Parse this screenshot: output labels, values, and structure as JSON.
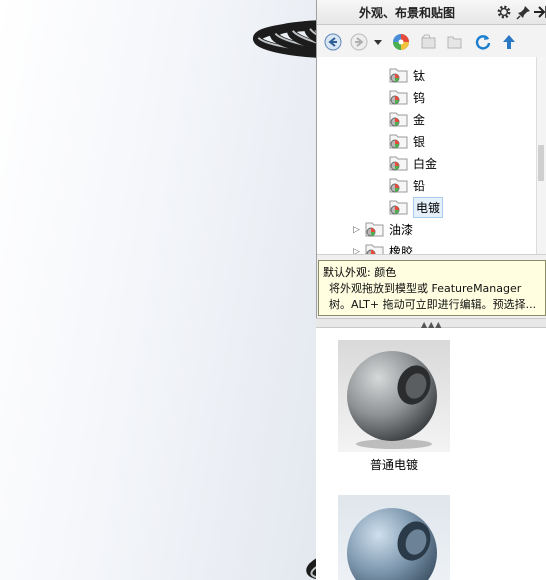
{
  "panel": {
    "title": "外观、布景和贴图",
    "tree": [
      {
        "label": "钛",
        "selected": false
      },
      {
        "label": "钨",
        "selected": false
      },
      {
        "label": "金",
        "selected": false
      },
      {
        "label": "银",
        "selected": false
      },
      {
        "label": "白金",
        "selected": false
      },
      {
        "label": "铅",
        "selected": false
      },
      {
        "label": "电镀",
        "selected": true
      },
      {
        "label": "油漆",
        "selected": false
      },
      {
        "label": "橡胶",
        "selected": false
      }
    ],
    "tooltip": {
      "header": "默认外观: 颜色",
      "body": "将外观拖放到模型或 FeatureManager 树。ALT+ 拖动可立即进行编辑。预选择..."
    },
    "swatches": [
      {
        "caption": "普通电镀",
        "colors": {
          "base": "#8e9294",
          "light": "#d6d9da",
          "dark": "#3b3e40"
        }
      },
      {
        "caption": "",
        "colors": {
          "base": "#7d97ae",
          "light": "#cfe0ee",
          "dark": "#3e5366"
        }
      }
    ]
  },
  "icons": {
    "settings": "gear-icon",
    "pin": "pin-icon",
    "expand": "arrow-right-icon",
    "back": "back-arrow-icon",
    "forward": "forward-arrow-icon",
    "dropdown": "dropdown-triangle-icon",
    "appearance": "color-palette-icon",
    "new_folder": "new-folder-icon",
    "open_folder": "open-folder-icon",
    "refresh": "refresh-icon",
    "up": "up-arrow-icon"
  },
  "colors": {
    "accent_blue": "#1a6fc7",
    "tooltip_bg": "#fffee1",
    "coil_dark": "#1c1c1c",
    "coil_light": "#bfc3c6"
  }
}
